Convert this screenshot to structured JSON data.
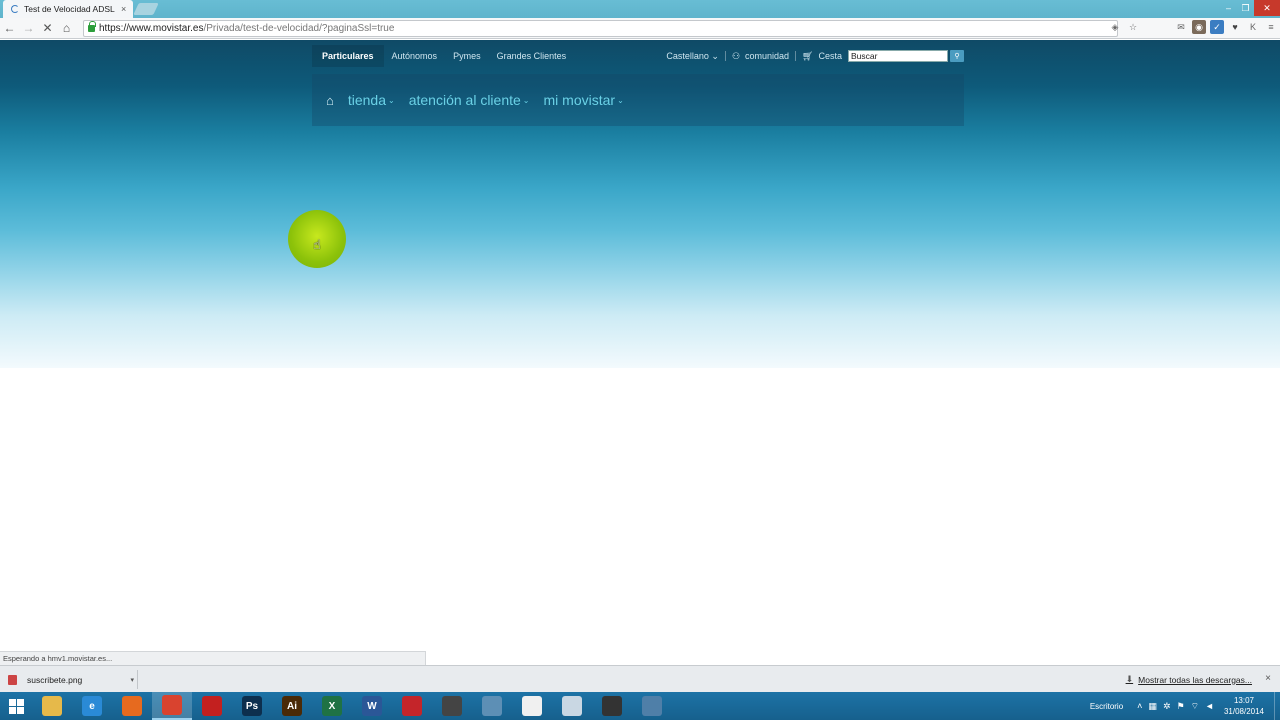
{
  "browser": {
    "tab_title": "Test de Velocidad ADSL y",
    "tab_close": "×",
    "url_host": "https://www.movistar.es",
    "url_path": "/Privada/test-de-velocidad/?paginaSsl=true"
  },
  "topnav": {
    "segments": [
      "Particulares",
      "Autónomos",
      "Pymes",
      "Grandes Clientes"
    ],
    "language": "Castellano",
    "comunidad": "comunidad",
    "cesta": "Cesta",
    "search_value": "Buscar"
  },
  "mainnav": {
    "items": [
      "tienda",
      "atención al cliente",
      "mi movistar"
    ]
  },
  "status_text": "Esperando a hmv1.movistar.es...",
  "downloads": {
    "file_name": "suscribete.png",
    "show_all": "Mostrar todas las descargas...",
    "close": "×"
  },
  "taskbar": {
    "apps": [
      {
        "icon": "file-explorer-icon",
        "label": "",
        "color": "#e6b94a"
      },
      {
        "icon": "internet-explorer-icon",
        "label": "e",
        "color": "#2a8ad6"
      },
      {
        "icon": "firefox-icon",
        "label": "",
        "color": "#e66a1f"
      },
      {
        "icon": "chrome-icon",
        "label": "",
        "color": "#d9432f"
      },
      {
        "icon": "acrobat-icon",
        "label": "",
        "color": "#c3201f"
      },
      {
        "icon": "photoshop-icon",
        "label": "Ps",
        "color": "#0d2f4e"
      },
      {
        "icon": "illustrator-icon",
        "label": "Ai",
        "color": "#4a2a07"
      },
      {
        "icon": "excel-icon",
        "label": "X",
        "color": "#1f7244"
      },
      {
        "icon": "word-icon",
        "label": "W",
        "color": "#2b5797"
      },
      {
        "icon": "poker-icon",
        "label": "",
        "color": "#c4252a"
      },
      {
        "icon": "inkscape-icon",
        "label": "",
        "color": "#444444"
      },
      {
        "icon": "magnifier-icon",
        "label": "",
        "color": "#5d8fb5"
      },
      {
        "icon": "blank-document-icon",
        "label": "",
        "color": "#f0f0f0"
      },
      {
        "icon": "notepad-icon",
        "label": "",
        "color": "#c9d7e3"
      },
      {
        "icon": "recorder-icon",
        "label": "",
        "color": "#333333"
      },
      {
        "icon": "remote-desktop-icon",
        "label": "",
        "color": "#4f7fa8"
      }
    ],
    "desktop_label": "Escritorio",
    "time": "13:07",
    "date": "31/08/2014"
  }
}
